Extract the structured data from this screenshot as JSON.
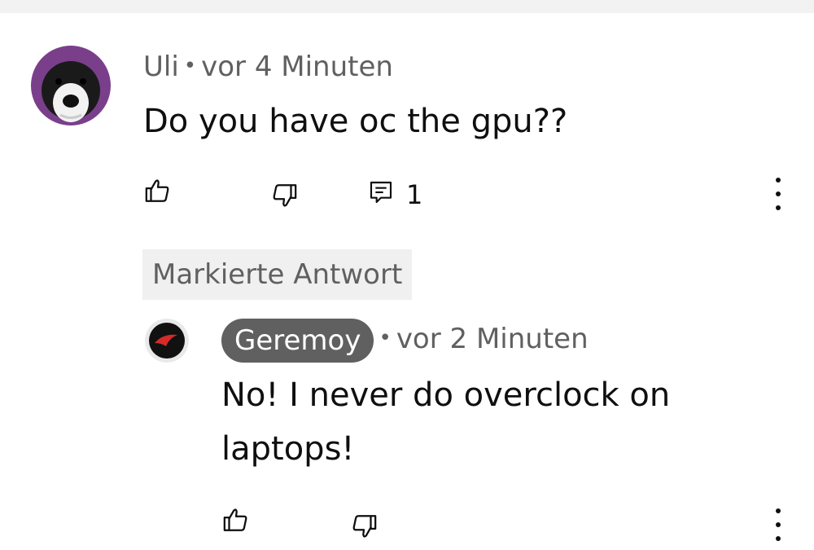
{
  "comment": {
    "author": "Uli",
    "time": "vor 4 Minuten",
    "text": "Do you have oc the gpu??",
    "reply_count": "1"
  },
  "marked_label": "Markierte Antwort",
  "reply": {
    "author": "Geremoy",
    "time": "vor 2 Minuten",
    "text": "No! I never do overclock on laptops!"
  },
  "icons": {
    "like": "thumbs-up-icon",
    "dislike": "thumbs-down-icon",
    "replies": "comment-icon",
    "more": "more-vert-icon"
  },
  "colors": {
    "meta_text": "#606060",
    "author_chip_bg": "#606060",
    "marked_bg": "#f0f0f0"
  }
}
